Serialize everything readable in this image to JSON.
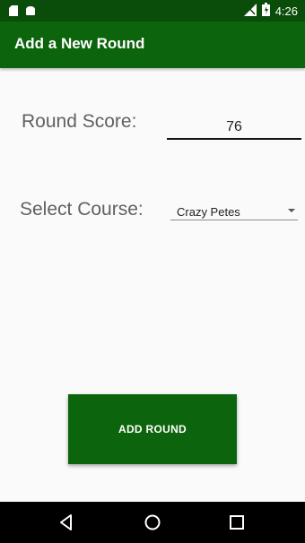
{
  "status_bar": {
    "time": "4:26",
    "icons": [
      "sd-card-icon",
      "android-icon",
      "signal-off-icon",
      "battery-icon"
    ]
  },
  "app_bar": {
    "title": "Add a New Round"
  },
  "form": {
    "score_label": "Round Score:",
    "score_value": "76",
    "course_label": "Select Course:",
    "course_selected": "Crazy Petes"
  },
  "actions": {
    "add_round_label": "ADD ROUND"
  },
  "nav_bar": {
    "buttons": [
      "back-icon",
      "home-icon",
      "recents-icon"
    ]
  },
  "colors": {
    "primary": "#0c640c",
    "primary_dark": "#0a4d0a",
    "background": "#fafafa",
    "label_text": "#616161"
  }
}
